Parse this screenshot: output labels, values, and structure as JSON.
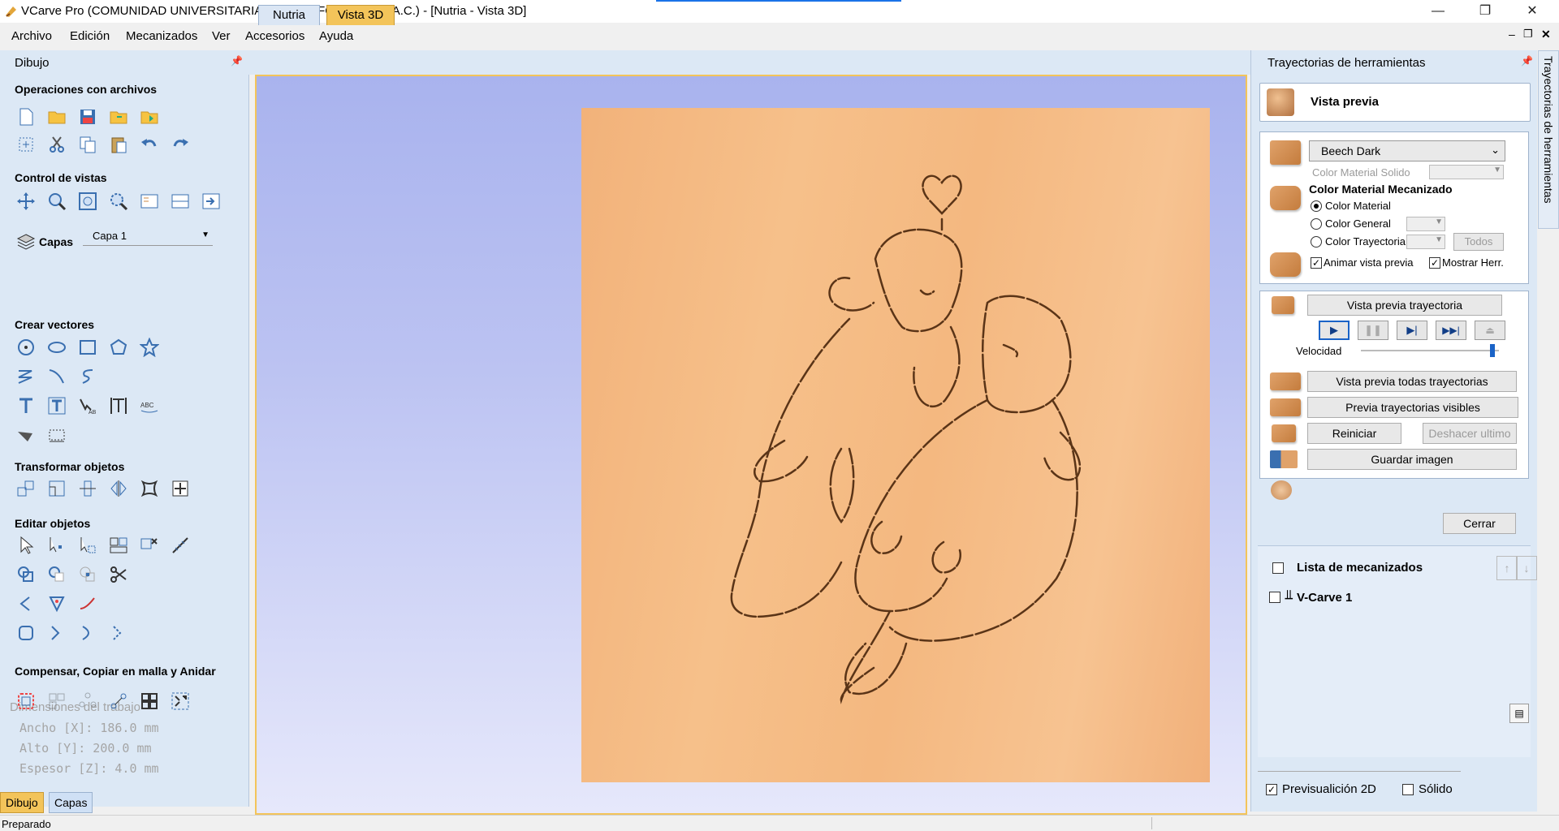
{
  "window": {
    "title": "VCarve Pro (COMUNIDAD UNIVERSITARIA DEL GOLFO CENTRO  A.C.) - [Nutria - Vista 3D]",
    "minimize": "—",
    "restore": "❐",
    "close": "✕",
    "mdi_min": "–",
    "mdi_restore": "❐",
    "mdi_close": "✕"
  },
  "menu": [
    "Archivo",
    "Edición",
    "Mecanizados",
    "Ver",
    "Accesorios",
    "Ayuda"
  ],
  "left_panel": {
    "title": "Dibujo",
    "sections": {
      "file_ops": "Operaciones con archivos",
      "view_control": "Control de vistas",
      "layers_label": "Capas",
      "layer_value": "Capa 1",
      "create_vectors": "Crear vectores",
      "transform": "Transformar objetos",
      "edit": "Editar objetos",
      "offset": "Compensar, Copiar en malla y Anidar",
      "dims_overlay": "Dimensiones del trabajo"
    },
    "dims": {
      "width": "Ancho  [X]: 186.0 mm",
      "height": "Alto   [Y]: 200.0 mm",
      "thickness": "Espesor [Z]: 4.0 mm"
    },
    "bottom_tabs": [
      "Dibujo",
      "Capas"
    ]
  },
  "view_tabs": [
    "Nutria",
    "Vista 3D"
  ],
  "right_panel": {
    "title": "Trayectorias de herramientas",
    "header": "Vista previa",
    "material": "Beech Dark",
    "solid_color_label": "Color Material Solido",
    "machined_color_title": "Color Material Mecanizado",
    "radio_material": "Color Material",
    "radio_general": "Color General",
    "radio_toolpath": "Color Trayectoria",
    "todos": "Todos",
    "animate": "Animar vista previa",
    "show_tool": "Mostrar Herr.",
    "preview_toolpath": "Vista previa trayectoria",
    "speed": "Velocidad",
    "speed_value": 0.97,
    "preview_all": "Vista previa todas trayectorias",
    "preview_visible": "Previa trayectorias visibles",
    "reset": "Reiniciar",
    "undo_last": "Deshacer ultimo",
    "save_image": "Guardar imagen",
    "close": "Cerrar",
    "toolpath_list_title": "Lista de mecanizados",
    "toolpath_item": "V-Carve 1",
    "preview2d": "Previsualición 2D",
    "solid": "Sólido"
  },
  "side_tab": "Trayectorias de herramientas",
  "status": "Preparado",
  "colors": {
    "accent": "#f3c45a",
    "panel": "#dce8f5",
    "button_blue": "#1a63c7"
  }
}
